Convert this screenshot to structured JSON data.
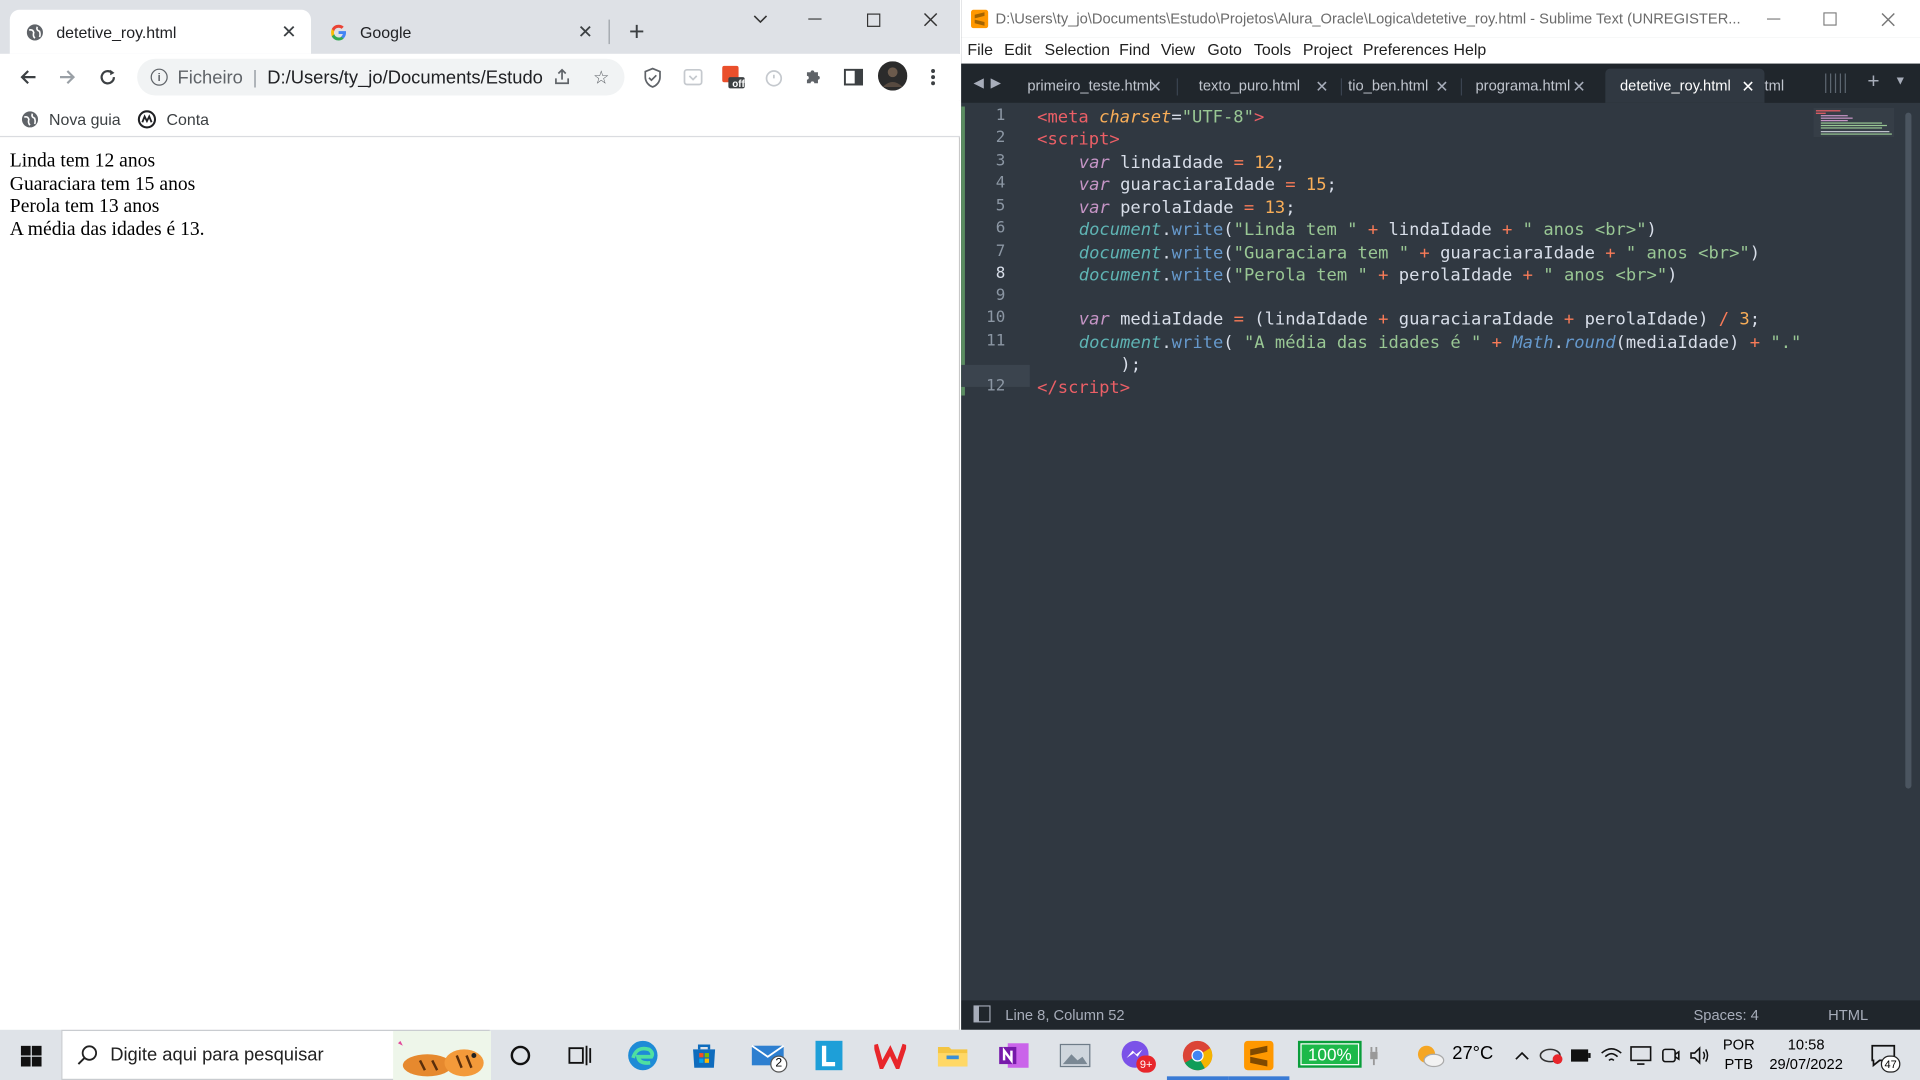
{
  "chrome": {
    "tabs": [
      {
        "title": "detetive_roy.html",
        "active": true,
        "icon": "globe-icon"
      },
      {
        "title": "Google",
        "active": false,
        "icon": "google-icon"
      }
    ],
    "address": {
      "scheme": "Ficheiro",
      "url": "D:/Users/ty_jo/Documents/Estudo..."
    },
    "bookmarks": [
      {
        "label": "Nova guia",
        "icon": "globe-icon"
      },
      {
        "label": "Conta",
        "icon": "conta-icon"
      }
    ],
    "extension_badge": "off",
    "page_lines": [
      "Linda tem 12 anos",
      "Guaraciara tem 15 anos",
      "Perola tem 13 anos",
      "A média das idades é 13."
    ]
  },
  "sublime": {
    "title": "D:\\Users\\ty_jo\\Documents\\Estudo\\Projetos\\Alura_Oracle\\Logica\\detetive_roy.html - Sublime Text (UNREGISTER...",
    "menu": [
      "File",
      "Edit",
      "Selection",
      "Find",
      "View",
      "Goto",
      "Tools",
      "Project",
      "Preferences",
      "Help"
    ],
    "tabs": [
      "primeiro_teste.html",
      "texto_puro.html",
      "tio_ben.html",
      "programa.html",
      "detetive_roy.html",
      "tml"
    ],
    "active_tab": "detetive_roy.html",
    "line_numbers": [
      "1",
      "2",
      "3",
      "4",
      "5",
      "6",
      "7",
      "8",
      "9",
      "10",
      "11",
      "",
      "12"
    ],
    "current_line": "8",
    "status": {
      "position": "Line 8, Column 52",
      "spaces": "Spaces: 4",
      "syntax": "HTML"
    },
    "colors": {
      "background": "#303841",
      "keyword": "#c695c6",
      "tag": "#ec5f66",
      "string": "#99c794",
      "number": "#f9ae58",
      "operator": "#f97b58"
    }
  },
  "code": {
    "l1": {
      "t1": "<",
      "t2": "meta",
      "t3": "charset",
      "t4": "=",
      "t5": "\"UTF-8\"",
      "t6": ">"
    },
    "l2": {
      "t1": "<",
      "t2": "script",
      "t3": ">"
    },
    "l3": {
      "kw": "var",
      "name": " lindaIdade ",
      "op": "=",
      "sp": " ",
      "num": "12",
      "end": ";"
    },
    "l4": {
      "kw": "var",
      "name": " guaraciaraIdade ",
      "op": "=",
      "sp": " ",
      "num": "15",
      "end": ";"
    },
    "l5": {
      "kw": "var",
      "name": " perolaIdade ",
      "op": "=",
      "sp": " ",
      "num": "13",
      "end": ";"
    },
    "l6": {
      "doc": "document",
      "dot": ".",
      "fn": "write",
      "p1": "(",
      "s1": "\"Linda tem \"",
      "o1": " + ",
      "v1": "lindaIdade",
      "o2": " + ",
      "s2": "\" anos <br>\"",
      "p2": ")"
    },
    "l7": {
      "doc": "document",
      "dot": ".",
      "fn": "write",
      "p1": "(",
      "s1": "\"Guaraciara tem \"",
      "o1": " + ",
      "v1": "guaraciaraIdade",
      "o2": " + ",
      "s2": "\" anos <br>\"",
      "p2": ")"
    },
    "l8": {
      "doc": "document",
      "dot": ".",
      "fn": "write",
      "p1": "(",
      "s1": "\"Perola tem \"",
      "o1": " + ",
      "v1": "perolaIdade",
      "o2": " + ",
      "s2": "\" anos <br>\"",
      "p2": ")"
    },
    "l10": {
      "kw": "var",
      "name": " mediaIdade ",
      "op": "=",
      "a": " (lindaIdade ",
      "o1": "+",
      "b": " guaraciaraIdade ",
      "o2": "+",
      "c": " perolaIdade) ",
      "o3": "/",
      "sp": " ",
      "num": "3",
      "end": ";"
    },
    "l11": {
      "doc": "document",
      "dot": ".",
      "fn": "write",
      "p1": "( ",
      "s1": "\"A média das idades é \"",
      "o1": " + ",
      "m": "Math",
      "dot2": ".",
      "fn2": "round",
      "v1": "(mediaIdade)",
      "o2": " + ",
      "s2": "\".\""
    },
    "l11b": {
      "t": ");"
    },
    "l12": {
      "t1": "</",
      "t2": "script",
      "t3": ">"
    }
  },
  "taskbar": {
    "search_placeholder": "Digite aqui para pesquisar",
    "mail_badge": "2",
    "messenger_badge": "9+",
    "battery": "100%",
    "weather": "27°C",
    "lang1": "POR",
    "lang2": "PTB",
    "time": "10:58",
    "date": "29/07/2022",
    "notifications": "47"
  }
}
